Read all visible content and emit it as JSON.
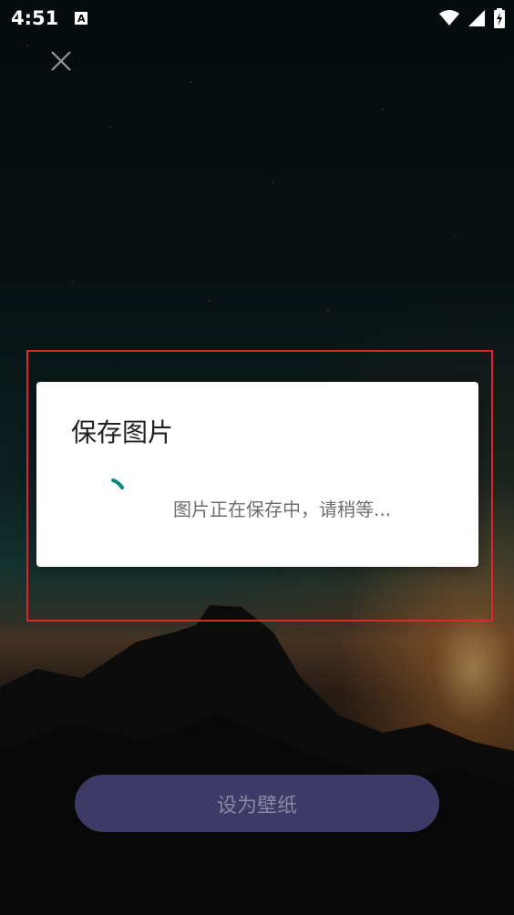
{
  "status_bar": {
    "time": "4:51",
    "notification_icon_label": "A",
    "icons": [
      "wifi-icon",
      "signal-icon",
      "battery-charging-icon"
    ]
  },
  "toolbar": {
    "close_icon": "close-icon"
  },
  "dialog": {
    "title": "保存图片",
    "message": "图片正在保存中，请稍等...",
    "spinner_color": "#00897B"
  },
  "main": {
    "set_wallpaper_label": "设为壁纸",
    "button_color": "#3D3A68"
  },
  "highlight_color": "#E0262C"
}
